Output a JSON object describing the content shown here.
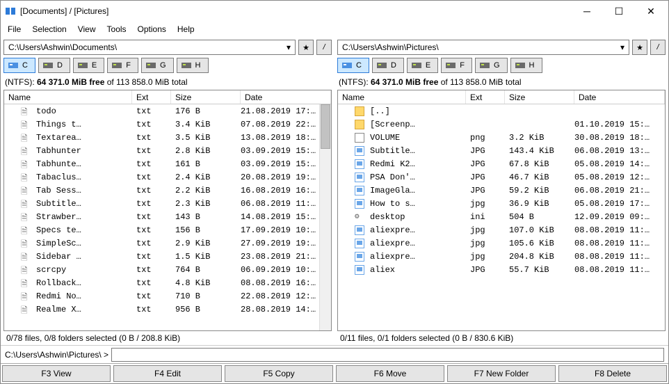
{
  "title": "[Documents] / [Pictures]",
  "menu": [
    "File",
    "Selection",
    "View",
    "Tools",
    "Options",
    "Help"
  ],
  "drives": [
    "C",
    "D",
    "E",
    "F",
    "G",
    "H"
  ],
  "diskstat": {
    "prefix": "(NTFS): ",
    "free": "64 371.0 MiB free",
    "of": " of 113 858.0 MiB total"
  },
  "cols": {
    "name": "Name",
    "ext": "Ext",
    "size": "Size",
    "date": "Date"
  },
  "left": {
    "path": "C:\\Users\\Ashwin\\Documents\\",
    "selstat": "0/78 files, 0/8 folders selected (0 B / 208.8 KiB)",
    "rows": [
      {
        "ic": "doc",
        "name": "todo",
        "ext": "txt",
        "size": "176 B",
        "date": "21.08.2019 17:…"
      },
      {
        "ic": "doc",
        "name": "Things t…",
        "ext": "txt",
        "size": "3.4 KiB",
        "date": "07.08.2019 22:…"
      },
      {
        "ic": "doc",
        "name": "Textarea…",
        "ext": "txt",
        "size": "3.5 KiB",
        "date": "13.08.2019 18:…"
      },
      {
        "ic": "doc",
        "name": "Tabhunter",
        "ext": "txt",
        "size": "2.8 KiB",
        "date": "03.09.2019 15:…"
      },
      {
        "ic": "doc",
        "name": "Tabhunte…",
        "ext": "txt",
        "size": "161 B",
        "date": "03.09.2019 15:…"
      },
      {
        "ic": "doc",
        "name": "Tabaclus…",
        "ext": "txt",
        "size": "2.4 KiB",
        "date": "20.08.2019 19:…"
      },
      {
        "ic": "doc",
        "name": "Tab Sess…",
        "ext": "txt",
        "size": "2.2 KiB",
        "date": "16.08.2019 16:…"
      },
      {
        "ic": "doc",
        "name": "Subtitle…",
        "ext": "txt",
        "size": "2.3 KiB",
        "date": "06.08.2019 11:…"
      },
      {
        "ic": "doc",
        "name": "Strawber…",
        "ext": "txt",
        "size": "143 B",
        "date": "14.08.2019 15:…"
      },
      {
        "ic": "doc",
        "name": "Specs te…",
        "ext": "txt",
        "size": "156 B",
        "date": "17.09.2019 10:…"
      },
      {
        "ic": "doc",
        "name": "SimpleSc…",
        "ext": "txt",
        "size": "2.9 KiB",
        "date": "27.09.2019 19:…"
      },
      {
        "ic": "doc",
        "name": "Sidebar …",
        "ext": "txt",
        "size": "1.5 KiB",
        "date": "23.08.2019 21:…"
      },
      {
        "ic": "doc",
        "name": "scrcpy",
        "ext": "txt",
        "size": "764 B",
        "date": "06.09.2019 10:…"
      },
      {
        "ic": "doc",
        "name": "Rollback…",
        "ext": "txt",
        "size": "4.8 KiB",
        "date": "08.08.2019 16:…"
      },
      {
        "ic": "doc",
        "name": "Redmi No…",
        "ext": "txt",
        "size": "710 B",
        "date": "22.08.2019 12:…"
      },
      {
        "ic": "doc",
        "name": "Realme X…",
        "ext": "txt",
        "size": "956 B",
        "date": "28.08.2019 14:…"
      }
    ]
  },
  "right": {
    "path": "C:\\Users\\Ashwin\\Pictures\\",
    "selstat": "0/11 files, 0/1 folders selected (0 B / 830.6 KiB)",
    "rows": [
      {
        "ic": "fold",
        "name": "[..]",
        "ext": "",
        "size": "",
        "date": ""
      },
      {
        "ic": "fold",
        "name": "[Screenp…",
        "ext": "",
        "size": "",
        "date": "01.10.2019 15:…"
      },
      {
        "ic": "vol",
        "name": "VOLUME",
        "ext": "png",
        "size": "3.2 KiB",
        "date": "30.08.2019 18:…"
      },
      {
        "ic": "img",
        "name": "Subtitle…",
        "ext": "JPG",
        "size": "143.4 KiB",
        "date": "06.08.2019 13:…"
      },
      {
        "ic": "img",
        "name": "Redmi K2…",
        "ext": "JPG",
        "size": "67.8 KiB",
        "date": "05.08.2019 14:…"
      },
      {
        "ic": "img",
        "name": "PSA Don'…",
        "ext": "JPG",
        "size": "46.7 KiB",
        "date": "05.08.2019 12:…"
      },
      {
        "ic": "img",
        "name": "ImageGla…",
        "ext": "JPG",
        "size": "59.2 KiB",
        "date": "06.08.2019 21:…"
      },
      {
        "ic": "img",
        "name": "How to s…",
        "ext": "jpg",
        "size": "36.9 KiB",
        "date": "05.08.2019 17:…"
      },
      {
        "ic": "ini",
        "name": "desktop",
        "ext": "ini",
        "size": "504 B",
        "date": "12.09.2019 09:…"
      },
      {
        "ic": "img",
        "name": "aliexpre…",
        "ext": "jpg",
        "size": "107.0 KiB",
        "date": "08.08.2019 11:…"
      },
      {
        "ic": "img",
        "name": "aliexpre…",
        "ext": "jpg",
        "size": "105.6 KiB",
        "date": "08.08.2019 11:…"
      },
      {
        "ic": "img",
        "name": "aliexpre…",
        "ext": "jpg",
        "size": "204.8 KiB",
        "date": "08.08.2019 11:…"
      },
      {
        "ic": "img",
        "name": "aliex",
        "ext": "JPG",
        "size": "55.7 KiB",
        "date": "08.08.2019 11:…"
      }
    ]
  },
  "cmdline": "C:\\Users\\Ashwin\\Pictures\\  >",
  "fkeys": [
    "F3 View",
    "F4 Edit",
    "F5 Copy",
    "F6 Move",
    "F7 New Folder",
    "F8 Delete"
  ]
}
